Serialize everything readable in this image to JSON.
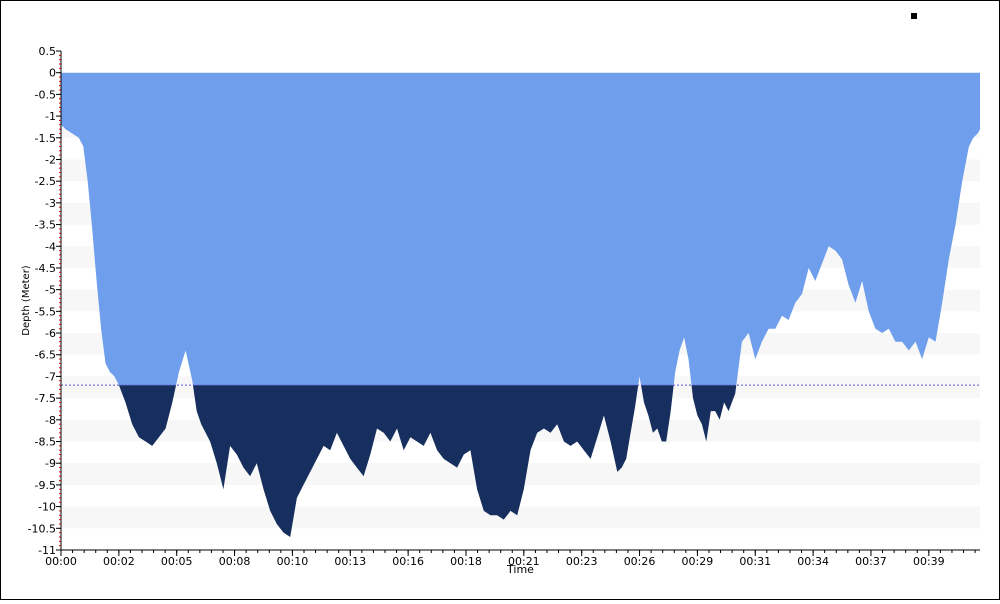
{
  "chart_data": {
    "type": "area",
    "title": "",
    "xlabel": "Time",
    "ylabel": "Depth (Meter)",
    "ylim": [
      -11,
      0.5
    ],
    "y_ticks": [
      0.5,
      0,
      -0.5,
      -1,
      -1.5,
      -2,
      -2.5,
      -3,
      -3.5,
      -4,
      -4.5,
      -5,
      -5.5,
      -6,
      -6.5,
      -7,
      -7.5,
      -8,
      -8.5,
      -9,
      -9.5,
      -10,
      -10.5,
      -11
    ],
    "x_tick_labels": [
      "00:00",
      "00:02",
      "00:05",
      "00:08",
      "00:10",
      "00:13",
      "00:16",
      "00:18",
      "00:21",
      "00:23",
      "00:26",
      "00:29",
      "00:31",
      "00:34",
      "00:37",
      "00:39"
    ],
    "x_tick_minutes": [
      0,
      2.6,
      5.2,
      7.8,
      10.4,
      13,
      15.6,
      18.2,
      20.8,
      23.4,
      26,
      28.6,
      31.2,
      33.8,
      36.4,
      39
    ],
    "xlim_minutes": [
      0,
      41.3
    ],
    "threshold_depth": -7.2,
    "legend": "top-right",
    "colors": {
      "area_upper": "#6f9fec",
      "area_lower": "#162f5e",
      "threshold_line": "#5555cc",
      "band": "#f7f7f7",
      "axis": "#000000",
      "minor_tick": "#cc0000"
    },
    "series": [
      {
        "x": [
          0,
          0.2,
          0.5,
          0.8,
          1.0,
          1.2,
          1.4,
          1.6,
          1.8,
          2.0,
          2.2,
          2.4,
          2.6,
          2.9,
          3.2,
          3.5,
          3.8,
          4.1,
          4.4,
          4.7,
          5.0,
          5.3,
          5.6,
          5.9,
          6.1,
          6.3,
          6.5,
          6.7,
          7.0,
          7.3,
          7.6,
          7.9,
          8.2,
          8.5,
          8.8,
          9.1,
          9.4,
          9.7,
          10.0,
          10.3,
          10.6,
          10.9,
          11.2,
          11.5,
          11.8,
          12.1,
          12.4,
          12.7,
          13.0,
          13.3,
          13.6,
          13.9,
          14.2,
          14.5,
          14.8,
          15.1,
          15.4,
          15.7,
          16.0,
          16.3,
          16.6,
          16.9,
          17.2,
          17.5,
          17.8,
          18.1,
          18.4,
          18.7,
          19.0,
          19.3,
          19.6,
          19.9,
          20.2,
          20.5,
          20.8,
          21.1,
          21.4,
          21.7,
          22.0,
          22.3,
          22.6,
          22.9,
          23.2,
          23.5,
          23.8,
          24.1,
          24.4,
          24.7,
          25.0,
          25.2,
          25.4,
          25.6,
          25.8,
          26.0,
          26.2,
          26.4,
          26.6,
          26.8,
          27.0,
          27.2,
          27.4,
          27.6,
          27.8,
          28.0,
          28.2,
          28.4,
          28.6,
          28.8,
          29.0,
          29.2,
          29.4,
          29.6,
          29.8,
          30.0,
          30.3,
          30.6,
          30.9,
          31.2,
          31.5,
          31.8,
          32.1,
          32.4,
          32.7,
          33.0,
          33.3,
          33.6,
          33.9,
          34.2,
          34.5,
          34.8,
          35.1,
          35.4,
          35.7,
          36.0,
          36.3,
          36.6,
          36.9,
          37.2,
          37.5,
          37.8,
          38.1,
          38.4,
          38.7,
          39.0,
          39.3,
          39.6,
          39.9,
          40.2,
          40.5,
          40.8,
          41.0,
          41.2,
          41.3
        ],
        "y": [
          -1.2,
          -1.3,
          -1.4,
          -1.5,
          -1.7,
          -2.5,
          -3.6,
          -4.8,
          -5.9,
          -6.7,
          -6.9,
          -7.0,
          -7.2,
          -7.6,
          -8.1,
          -8.4,
          -8.5,
          -8.6,
          -8.4,
          -8.2,
          -7.6,
          -6.9,
          -6.4,
          -7.1,
          -7.8,
          -8.1,
          -8.3,
          -8.5,
          -9.0,
          -9.6,
          -8.6,
          -8.8,
          -9.1,
          -9.3,
          -9.0,
          -9.6,
          -10.1,
          -10.4,
          -10.6,
          -10.7,
          -9.8,
          -9.5,
          -9.2,
          -8.9,
          -8.6,
          -8.7,
          -8.3,
          -8.6,
          -8.9,
          -9.1,
          -9.3,
          -8.8,
          -8.2,
          -8.3,
          -8.5,
          -8.2,
          -8.7,
          -8.4,
          -8.5,
          -8.6,
          -8.3,
          -8.7,
          -8.9,
          -9.0,
          -9.1,
          -8.8,
          -8.7,
          -9.6,
          -10.1,
          -10.2,
          -10.2,
          -10.3,
          -10.1,
          -10.2,
          -9.6,
          -8.7,
          -8.3,
          -8.2,
          -8.3,
          -8.1,
          -8.5,
          -8.6,
          -8.5,
          -8.7,
          -8.9,
          -8.4,
          -7.9,
          -8.5,
          -9.2,
          -9.1,
          -8.9,
          -8.3,
          -7.7,
          -7.0,
          -7.6,
          -7.9,
          -8.3,
          -8.2,
          -8.5,
          -8.5,
          -7.8,
          -6.9,
          -6.4,
          -6.1,
          -6.6,
          -7.5,
          -7.9,
          -8.1,
          -8.5,
          -7.8,
          -7.8,
          -8.0,
          -7.6,
          -7.8,
          -7.4,
          -6.2,
          -6.0,
          -6.6,
          -6.2,
          -5.9,
          -5.9,
          -5.6,
          -5.7,
          -5.3,
          -5.1,
          -4.5,
          -4.8,
          -4.4,
          -4.0,
          -4.1,
          -4.3,
          -4.9,
          -5.3,
          -4.8,
          -5.5,
          -5.9,
          -6.0,
          -5.9,
          -6.2,
          -6.2,
          -6.4,
          -6.2,
          -6.6,
          -6.1,
          -6.2,
          -5.3,
          -4.3,
          -3.5,
          -2.5,
          -1.7,
          -1.5,
          -1.4,
          -1.3
        ]
      }
    ]
  }
}
